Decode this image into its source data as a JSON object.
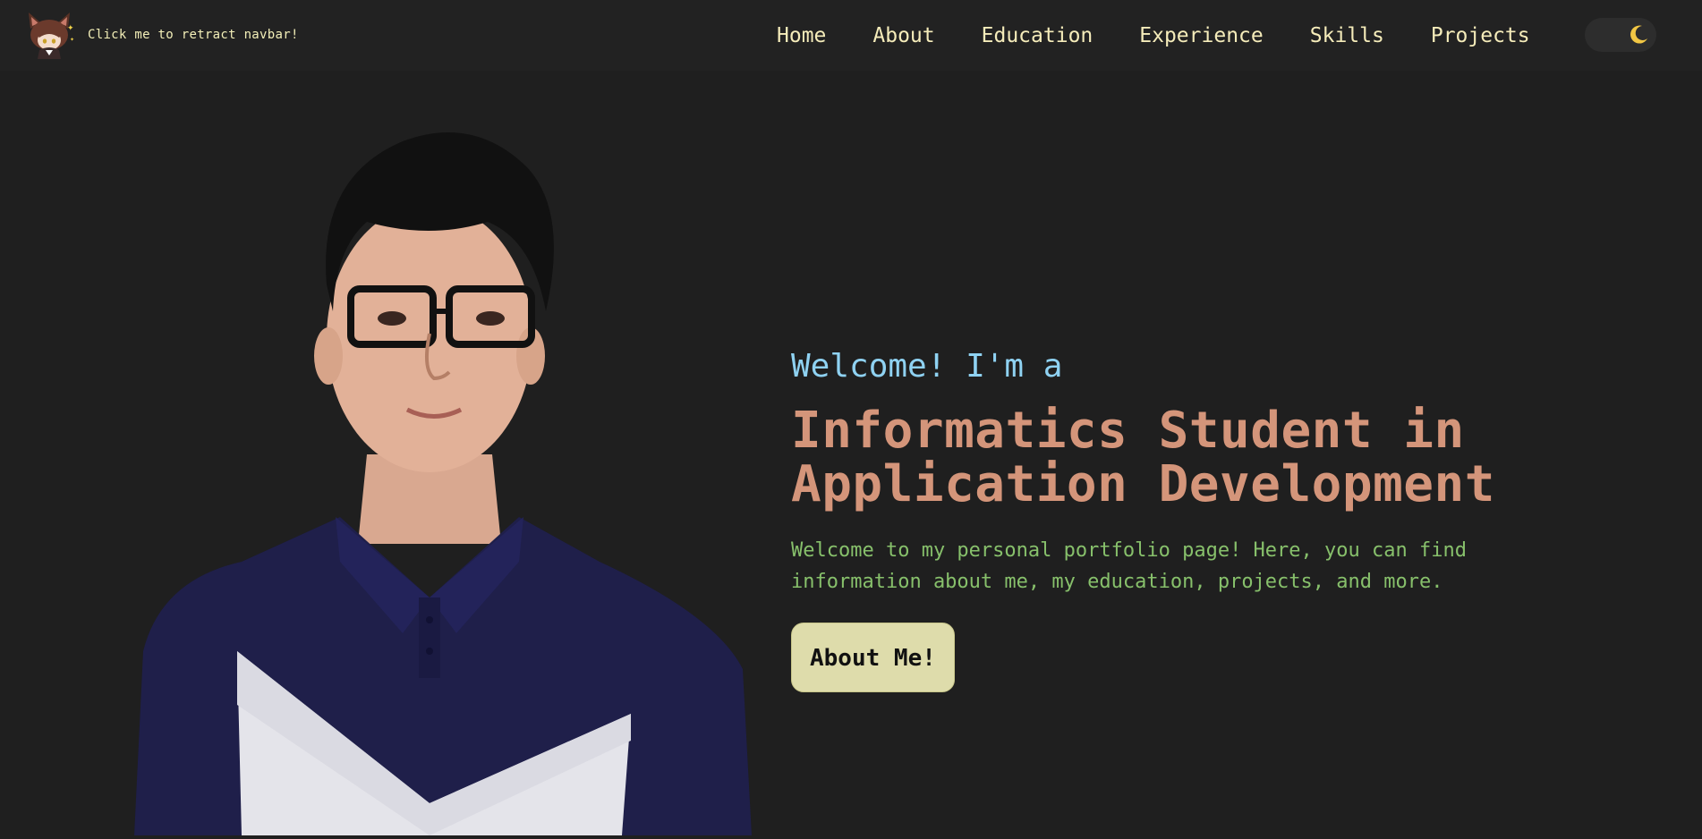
{
  "navbar": {
    "brand_text": "Click me to retract navbar!",
    "links": [
      {
        "label": "Home"
      },
      {
        "label": "About"
      },
      {
        "label": "Education"
      },
      {
        "label": "Experience"
      },
      {
        "label": "Skills"
      },
      {
        "label": "Projects"
      }
    ],
    "theme_toggle": {
      "icon": "moon-icon",
      "mode": "dark"
    }
  },
  "hero": {
    "intro": "Welcome! I'm a",
    "title_line1": "Informatics Student in",
    "title_line2": "Application Development",
    "description": "Welcome to my personal portfolio page! Here, you can find information about me, my education, projects, and more.",
    "cta_label": "About Me!"
  },
  "colors": {
    "background": "#1f1f1f",
    "navbar": "#222222",
    "nav_text": "#f5ecba",
    "intro": "#8fd2f2",
    "title": "#d4957a",
    "description": "#87c06b",
    "button": "#dedcab"
  }
}
